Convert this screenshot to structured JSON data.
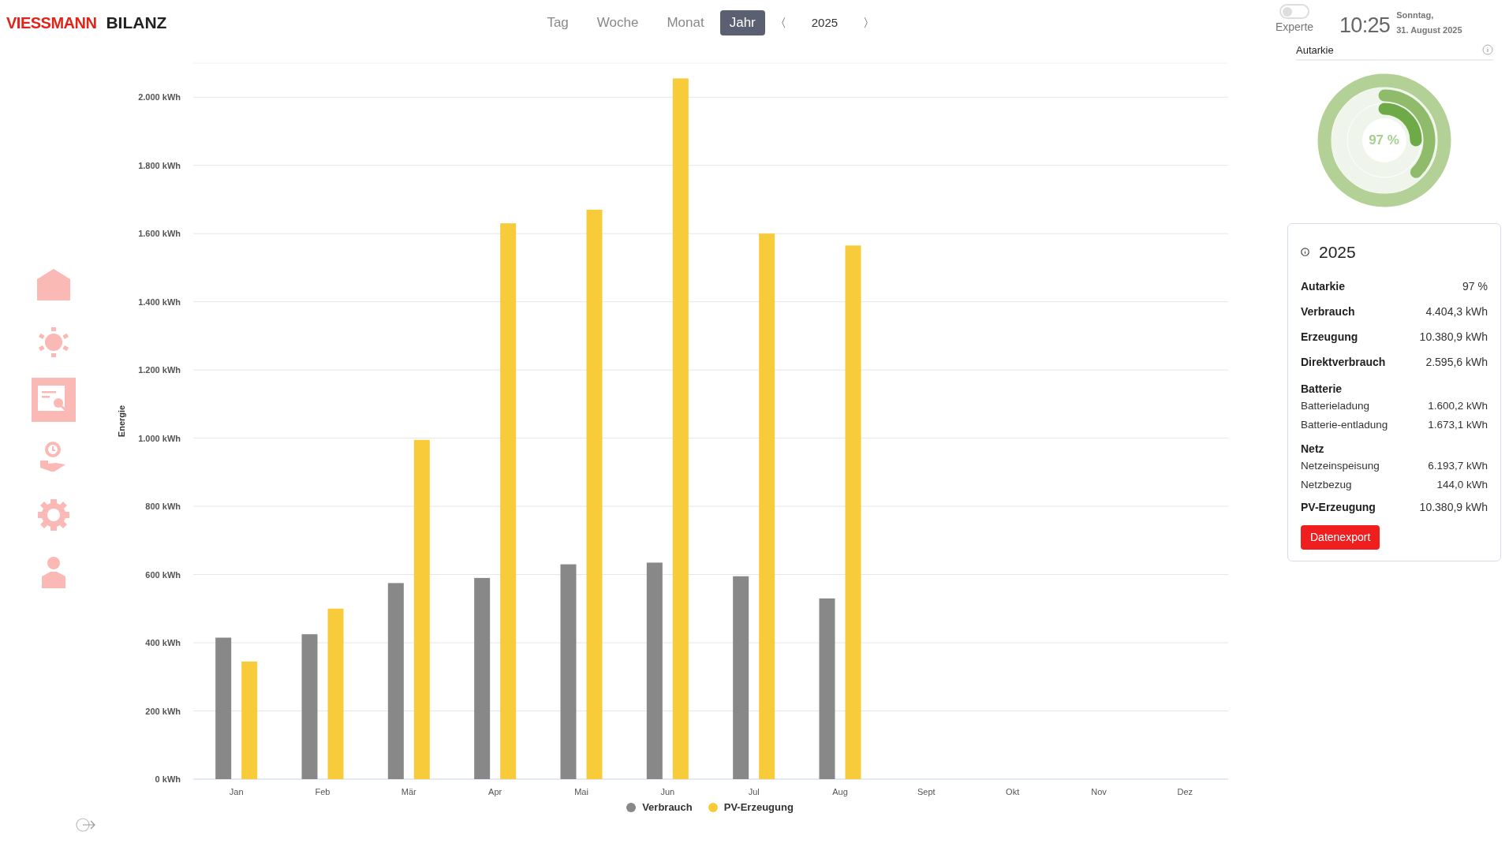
{
  "header": {
    "logo": "VIESSMANN",
    "title": "BILANZ"
  },
  "periods": [
    {
      "label": "Tag",
      "selected": false
    },
    {
      "label": "Woche",
      "selected": false
    },
    {
      "label": "Monat",
      "selected": false
    },
    {
      "label": "Jahr",
      "selected": true
    }
  ],
  "year_nav": {
    "prev": "〈",
    "year": "2025",
    "next": "〉"
  },
  "expert_toggle": {
    "label": "Experte",
    "on": false
  },
  "clock": {
    "time": "10:25",
    "weekday": "Sonntag,",
    "date": "31. August 2025"
  },
  "autarkie": {
    "title": "Autarkie",
    "value": "97 %"
  },
  "sidebar": {
    "items": [
      {
        "selected": false
      },
      {
        "selected": false
      },
      {
        "selected": true
      },
      {
        "selected": false
      },
      {
        "selected": false
      },
      {
        "selected": false
      }
    ]
  },
  "summary": {
    "title": "2025",
    "rows": [
      {
        "kind": "main",
        "label": "Autarkie",
        "value": "97 %"
      },
      {
        "kind": "main",
        "label": "Verbrauch",
        "value": "4.404,3 kWh"
      },
      {
        "kind": "main",
        "label": "Erzeugung",
        "value": "10.380,9 kWh"
      },
      {
        "kind": "main",
        "label": "Direktverbrauch",
        "value": "2.595,6 kWh"
      },
      {
        "kind": "heading",
        "label": "Batterie"
      },
      {
        "kind": "sub",
        "label": "Batterieladung",
        "value": "1.600,2 kWh"
      },
      {
        "kind": "sub",
        "label": "Batterie-entladung",
        "value": "1.673,1 kWh"
      },
      {
        "kind": "heading",
        "label": "Netz"
      },
      {
        "kind": "sub",
        "label": "Netzeinspeisung",
        "value": "6.193,7 kWh"
      },
      {
        "kind": "sub",
        "label": "Netzbezug",
        "value": "144,0 kWh"
      },
      {
        "kind": "main",
        "label": "PV-Erzeugung",
        "value": "10.380,9 kWh"
      }
    ],
    "button": "Datenexport"
  },
  "chart_data": {
    "type": "bar",
    "ylabel": "Energie",
    "categories": [
      "Jan",
      "Feb",
      "Mär",
      "Apr",
      "Mai",
      "Jun",
      "Jul",
      "Aug",
      "Sept",
      "Okt",
      "Nov",
      "Dez"
    ],
    "series": [
      {
        "name": "Verbrauch",
        "color": "#888888",
        "values": [
          415,
          425,
          575,
          590,
          630,
          635,
          595,
          530,
          null,
          null,
          null,
          null
        ]
      },
      {
        "name": "PV-Erzeugung",
        "color": "#f8cb3a",
        "values": [
          345,
          500,
          995,
          1630,
          1670,
          2055,
          1600,
          1565,
          null,
          null,
          null,
          null
        ]
      }
    ],
    "grid": true,
    "legend": true,
    "ylim": [
      0,
      2100
    ],
    "yticks": [
      {
        "value": 0,
        "label": "0 kWh"
      },
      {
        "value": 200,
        "label": "200 kWh"
      },
      {
        "value": 400,
        "label": "400 kWh"
      },
      {
        "value": 600,
        "label": "600 kWh"
      },
      {
        "value": 800,
        "label": "800 kWh"
      },
      {
        "value": 1000,
        "label": "1.000 kWh"
      },
      {
        "value": 1200,
        "label": "1.200 kWh"
      },
      {
        "value": 1400,
        "label": "1.400 kWh"
      },
      {
        "value": 1600,
        "label": "1.600 kWh"
      },
      {
        "value": 1800,
        "label": "1.800 kWh"
      },
      {
        "value": 2000,
        "label": "2.000 kWh"
      }
    ]
  }
}
